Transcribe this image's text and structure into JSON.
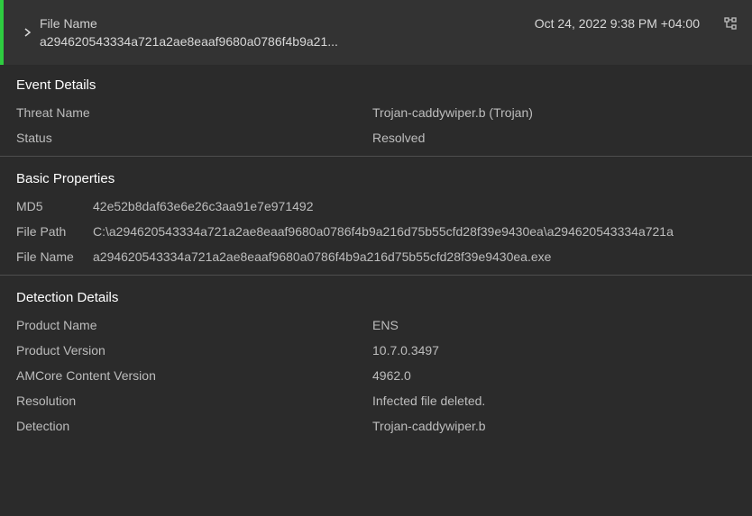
{
  "header": {
    "filename_label": "File Name",
    "filename_value": "a294620543334a721a2ae8eaaf9680a0786f4b9a21...",
    "timestamp": "Oct 24, 2022 9:38 PM +04:00"
  },
  "event_details": {
    "title": "Event Details",
    "threat_name_label": "Threat Name",
    "threat_name_value": "Trojan-caddywiper.b (Trojan)",
    "status_label": "Status",
    "status_value": "Resolved"
  },
  "basic_properties": {
    "title": "Basic Properties",
    "md5_label": "MD5",
    "md5_value": "42e52b8daf63e6e26c3aa91e7e971492",
    "file_path_label": "File Path",
    "file_path_value": "C:\\a294620543334a721a2ae8eaaf9680a0786f4b9a216d75b55cfd28f39e9430ea\\a294620543334a721a",
    "file_name_label": "File Name",
    "file_name_value": "a294620543334a721a2ae8eaaf9680a0786f4b9a216d75b55cfd28f39e9430ea.exe"
  },
  "detection_details": {
    "title": "Detection Details",
    "product_name_label": "Product Name",
    "product_name_value": "ENS",
    "product_version_label": "Product Version",
    "product_version_value": "10.7.0.3497",
    "amcore_label": "AMCore Content Version",
    "amcore_value": "4962.0",
    "resolution_label": "Resolution",
    "resolution_value": "Infected file deleted.",
    "detection_label": "Detection",
    "detection_value": "Trojan-caddywiper.b"
  }
}
